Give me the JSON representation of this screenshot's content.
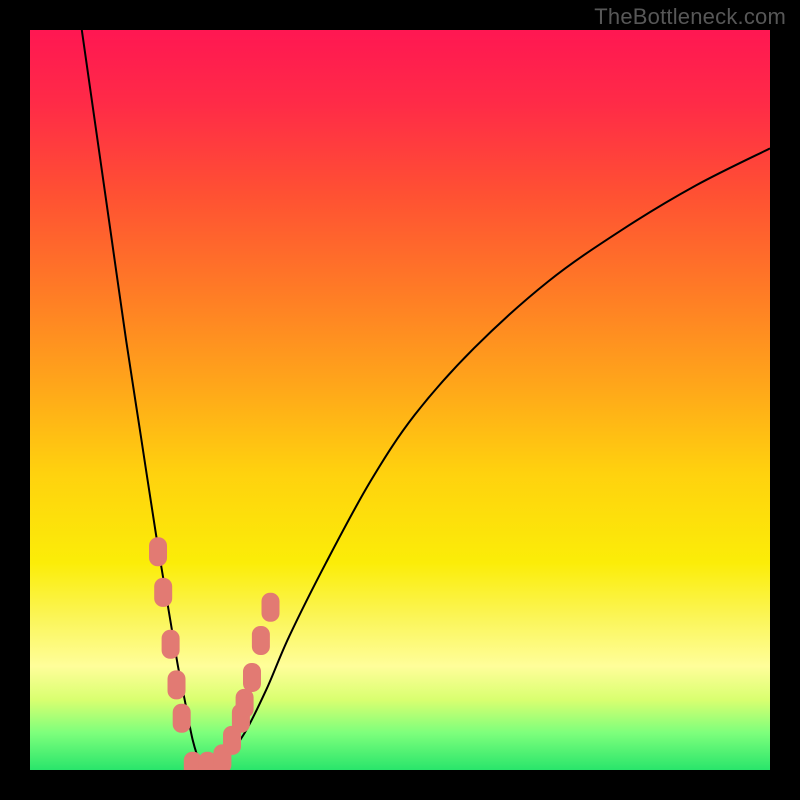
{
  "watermark": {
    "text": "TheBottleneck.com"
  },
  "colors": {
    "black": "#000000",
    "curve": "#000000",
    "marker_fill": "#e27a73",
    "marker_stroke": "#e27a73",
    "gradient_stops": [
      {
        "offset": 0.0,
        "color": "#ff1752"
      },
      {
        "offset": 0.1,
        "color": "#ff2b47"
      },
      {
        "offset": 0.22,
        "color": "#ff5033"
      },
      {
        "offset": 0.35,
        "color": "#ff7a26"
      },
      {
        "offset": 0.48,
        "color": "#ffa61a"
      },
      {
        "offset": 0.6,
        "color": "#ffd20e"
      },
      {
        "offset": 0.72,
        "color": "#fbed08"
      },
      {
        "offset": 0.8,
        "color": "#fbf65e"
      },
      {
        "offset": 0.86,
        "color": "#fffe9a"
      },
      {
        "offset": 0.905,
        "color": "#d9ff70"
      },
      {
        "offset": 0.95,
        "color": "#7dff7c"
      },
      {
        "offset": 1.0,
        "color": "#29e56b"
      }
    ]
  },
  "chart_data": {
    "type": "line",
    "title": "",
    "xlabel": "",
    "ylabel": "",
    "xlim": [
      0,
      100
    ],
    "ylim": [
      0,
      100
    ],
    "grid": false,
    "series": [
      {
        "name": "bottleneck-curve",
        "x": [
          7,
          9,
          11,
          13,
          15,
          17,
          19,
          20,
          21,
          22,
          23,
          24,
          26,
          29,
          32,
          35,
          40,
          46,
          52,
          60,
          70,
          80,
          90,
          100
        ],
        "y": [
          100,
          86,
          72,
          58,
          45,
          32,
          20,
          14,
          9,
          4,
          1,
          0,
          1,
          5,
          11,
          18,
          28,
          39,
          48,
          57,
          66,
          73,
          79,
          84
        ]
      }
    ],
    "markers": {
      "name": "highlighted-points",
      "shape": "rounded-rect",
      "x": [
        17.3,
        18.0,
        19.0,
        19.8,
        20.5,
        22.0,
        24.0,
        26.0,
        27.3,
        28.5,
        29.0,
        30.0,
        31.2,
        32.5
      ],
      "y": [
        29.5,
        24.0,
        17.0,
        11.5,
        7.0,
        0.5,
        0.5,
        1.5,
        4.0,
        7.0,
        9.0,
        12.5,
        17.5,
        22.0
      ]
    }
  }
}
